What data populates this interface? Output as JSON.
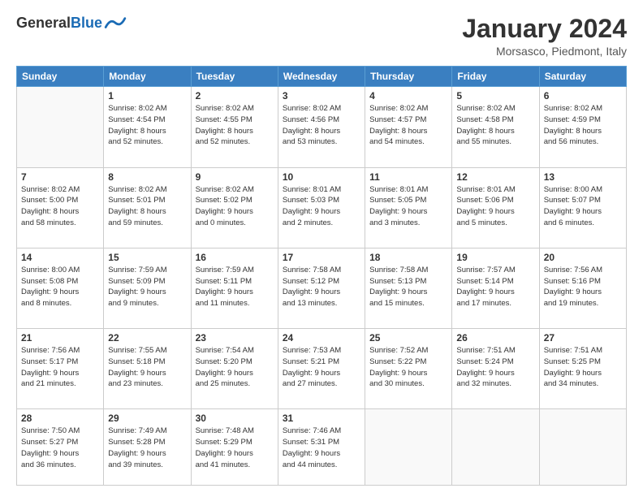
{
  "logo": {
    "general": "General",
    "blue": "Blue"
  },
  "title": "January 2024",
  "location": "Morsasco, Piedmont, Italy",
  "headers": [
    "Sunday",
    "Monday",
    "Tuesday",
    "Wednesday",
    "Thursday",
    "Friday",
    "Saturday"
  ],
  "weeks": [
    [
      {
        "day": "",
        "info": ""
      },
      {
        "day": "1",
        "info": "Sunrise: 8:02 AM\nSunset: 4:54 PM\nDaylight: 8 hours\nand 52 minutes."
      },
      {
        "day": "2",
        "info": "Sunrise: 8:02 AM\nSunset: 4:55 PM\nDaylight: 8 hours\nand 52 minutes."
      },
      {
        "day": "3",
        "info": "Sunrise: 8:02 AM\nSunset: 4:56 PM\nDaylight: 8 hours\nand 53 minutes."
      },
      {
        "day": "4",
        "info": "Sunrise: 8:02 AM\nSunset: 4:57 PM\nDaylight: 8 hours\nand 54 minutes."
      },
      {
        "day": "5",
        "info": "Sunrise: 8:02 AM\nSunset: 4:58 PM\nDaylight: 8 hours\nand 55 minutes."
      },
      {
        "day": "6",
        "info": "Sunrise: 8:02 AM\nSunset: 4:59 PM\nDaylight: 8 hours\nand 56 minutes."
      }
    ],
    [
      {
        "day": "7",
        "info": "Sunrise: 8:02 AM\nSunset: 5:00 PM\nDaylight: 8 hours\nand 58 minutes."
      },
      {
        "day": "8",
        "info": "Sunrise: 8:02 AM\nSunset: 5:01 PM\nDaylight: 8 hours\nand 59 minutes."
      },
      {
        "day": "9",
        "info": "Sunrise: 8:02 AM\nSunset: 5:02 PM\nDaylight: 9 hours\nand 0 minutes."
      },
      {
        "day": "10",
        "info": "Sunrise: 8:01 AM\nSunset: 5:03 PM\nDaylight: 9 hours\nand 2 minutes."
      },
      {
        "day": "11",
        "info": "Sunrise: 8:01 AM\nSunset: 5:05 PM\nDaylight: 9 hours\nand 3 minutes."
      },
      {
        "day": "12",
        "info": "Sunrise: 8:01 AM\nSunset: 5:06 PM\nDaylight: 9 hours\nand 5 minutes."
      },
      {
        "day": "13",
        "info": "Sunrise: 8:00 AM\nSunset: 5:07 PM\nDaylight: 9 hours\nand 6 minutes."
      }
    ],
    [
      {
        "day": "14",
        "info": "Sunrise: 8:00 AM\nSunset: 5:08 PM\nDaylight: 9 hours\nand 8 minutes."
      },
      {
        "day": "15",
        "info": "Sunrise: 7:59 AM\nSunset: 5:09 PM\nDaylight: 9 hours\nand 9 minutes."
      },
      {
        "day": "16",
        "info": "Sunrise: 7:59 AM\nSunset: 5:11 PM\nDaylight: 9 hours\nand 11 minutes."
      },
      {
        "day": "17",
        "info": "Sunrise: 7:58 AM\nSunset: 5:12 PM\nDaylight: 9 hours\nand 13 minutes."
      },
      {
        "day": "18",
        "info": "Sunrise: 7:58 AM\nSunset: 5:13 PM\nDaylight: 9 hours\nand 15 minutes."
      },
      {
        "day": "19",
        "info": "Sunrise: 7:57 AM\nSunset: 5:14 PM\nDaylight: 9 hours\nand 17 minutes."
      },
      {
        "day": "20",
        "info": "Sunrise: 7:56 AM\nSunset: 5:16 PM\nDaylight: 9 hours\nand 19 minutes."
      }
    ],
    [
      {
        "day": "21",
        "info": "Sunrise: 7:56 AM\nSunset: 5:17 PM\nDaylight: 9 hours\nand 21 minutes."
      },
      {
        "day": "22",
        "info": "Sunrise: 7:55 AM\nSunset: 5:18 PM\nDaylight: 9 hours\nand 23 minutes."
      },
      {
        "day": "23",
        "info": "Sunrise: 7:54 AM\nSunset: 5:20 PM\nDaylight: 9 hours\nand 25 minutes."
      },
      {
        "day": "24",
        "info": "Sunrise: 7:53 AM\nSunset: 5:21 PM\nDaylight: 9 hours\nand 27 minutes."
      },
      {
        "day": "25",
        "info": "Sunrise: 7:52 AM\nSunset: 5:22 PM\nDaylight: 9 hours\nand 30 minutes."
      },
      {
        "day": "26",
        "info": "Sunrise: 7:51 AM\nSunset: 5:24 PM\nDaylight: 9 hours\nand 32 minutes."
      },
      {
        "day": "27",
        "info": "Sunrise: 7:51 AM\nSunset: 5:25 PM\nDaylight: 9 hours\nand 34 minutes."
      }
    ],
    [
      {
        "day": "28",
        "info": "Sunrise: 7:50 AM\nSunset: 5:27 PM\nDaylight: 9 hours\nand 36 minutes."
      },
      {
        "day": "29",
        "info": "Sunrise: 7:49 AM\nSunset: 5:28 PM\nDaylight: 9 hours\nand 39 minutes."
      },
      {
        "day": "30",
        "info": "Sunrise: 7:48 AM\nSunset: 5:29 PM\nDaylight: 9 hours\nand 41 minutes."
      },
      {
        "day": "31",
        "info": "Sunrise: 7:46 AM\nSunset: 5:31 PM\nDaylight: 9 hours\nand 44 minutes."
      },
      {
        "day": "",
        "info": ""
      },
      {
        "day": "",
        "info": ""
      },
      {
        "day": "",
        "info": ""
      }
    ]
  ]
}
